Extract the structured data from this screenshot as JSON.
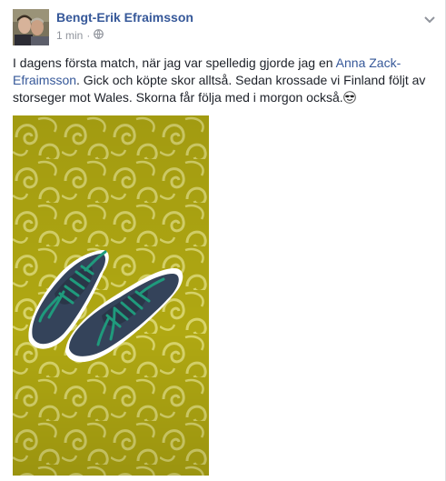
{
  "post": {
    "author": "Bengt-Erik Efraimsson",
    "time": "1 min",
    "separator": "·",
    "privacy_icon": "globe-icon",
    "menu_icon": "chevron-down-icon",
    "text_part1": "I dagens första match, när jag var spelledig gjorde jag en ",
    "mention": "Anna Zack-Efraimsson",
    "text_part2": ". Gick och köpte skor alltså. Sedan krossade vi Finland följt av storseger mot Wales. Skorna får följa med i morgon också.",
    "emoji_icon": "sunglasses-smiley-icon",
    "photo_icon": "sneakers-on-carpet-photo"
  },
  "colors": {
    "link": "#365899",
    "meta": "#90949c",
    "body_text": "#1d2129",
    "carpet": "#b5ae14",
    "shoe": "#36455c",
    "laces": "#1f9a7c"
  }
}
